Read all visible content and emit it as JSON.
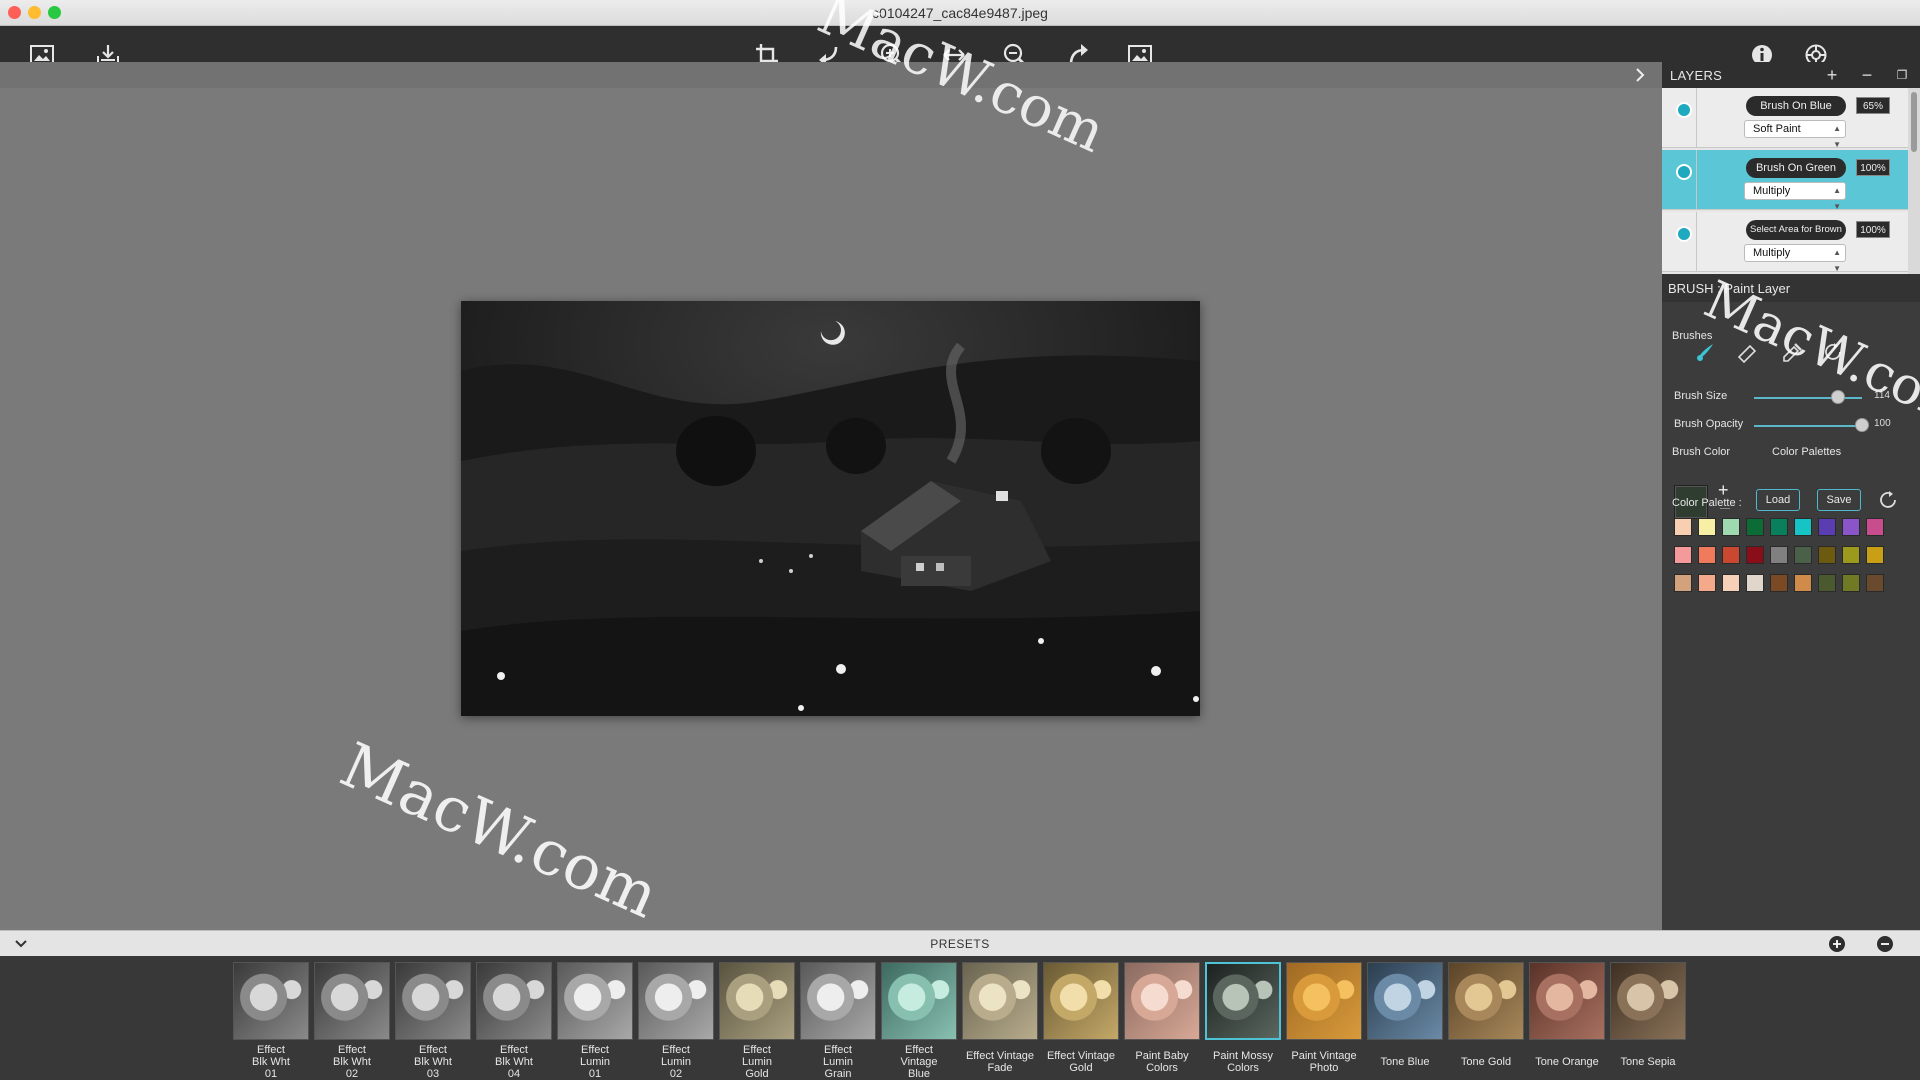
{
  "window": {
    "title": "c0104247_cac84e9487.jpeg"
  },
  "toolbar": {
    "left_icons": [
      "open-image-icon",
      "export-icon"
    ],
    "center_icons": [
      "crop-icon",
      "undo-icon",
      "zoom-in-icon",
      "fit-icon",
      "zoom-out-icon",
      "redo-icon",
      "compare-icon"
    ],
    "right_icons": [
      "info-icon",
      "settings-icon"
    ]
  },
  "layers": {
    "title": "LAYERS",
    "items": [
      {
        "name": "Brush On Blue",
        "opacity": "65%",
        "blend": "Soft Paint",
        "selected": false
      },
      {
        "name": "Brush On Green",
        "opacity": "100%",
        "blend": "Multiply",
        "selected": true
      },
      {
        "name": "Select Area for Brown",
        "opacity": "100%",
        "blend": "Multiply",
        "selected": false
      }
    ]
  },
  "brush": {
    "header": "BRUSH : Paint Layer",
    "brushes_label": "Brushes",
    "size_label": "Brush Size",
    "size_value": "114",
    "size_level": 0.78,
    "opacity_label": "Brush Opacity",
    "opacity_value": "100",
    "opacity_level": 1.0,
    "color_label": "Brush Color",
    "palettes_label": "Color Palettes",
    "load_label": "Load",
    "save_label": "Save",
    "palette_label": "Color Palette :",
    "current_color": "#2e3d30",
    "accent_color": "#4fb8cc",
    "palette_rows": [
      [
        "#f8cfb0",
        "#f6efa4",
        "#9ed9b0",
        "#0d6b36",
        "#0a7f5c",
        "#16c4c6",
        "#5a3db0",
        "#8a55c8",
        "#c84d8c"
      ],
      [
        "#f59a9a",
        "#ef7a5c",
        "#c9482f",
        "#8a0d1a",
        "#808080",
        "#4a6048",
        "#6b5a10",
        "#9b9a1c",
        "#c9a015"
      ],
      [
        "#d2a27c",
        "#f4a98b",
        "#f6d0b8",
        "#e0d6cc",
        "#7a4a24",
        "#d08a4a",
        "#4a5a2e",
        "#707a24",
        "#6a4a2c"
      ]
    ]
  },
  "presets": {
    "title": "PRESETS",
    "items": [
      {
        "label": "Effect\nBlk Wht\n01",
        "tone": "bw"
      },
      {
        "label": "Effect\nBlk Wht\n02",
        "tone": "bw"
      },
      {
        "label": "Effect\nBlk Wht\n03",
        "tone": "bw"
      },
      {
        "label": "Effect\nBlk Wht\n04",
        "tone": "bw"
      },
      {
        "label": "Effect\nLumin\n01",
        "tone": "bw-light"
      },
      {
        "label": "Effect\nLumin\n02",
        "tone": "bw-light"
      },
      {
        "label": "Effect\nLumin\nGold",
        "tone": "gold-pale"
      },
      {
        "label": "Effect\nLumin\nGrain",
        "tone": "bw-light"
      },
      {
        "label": "Effect\nVintage\nBlue",
        "tone": "mint"
      },
      {
        "label": "Effect Vintage\nFade",
        "tone": "fade"
      },
      {
        "label": "Effect Vintage\nGold",
        "tone": "gold"
      },
      {
        "label": "Paint Baby\nColors",
        "tone": "baby"
      },
      {
        "label": "Paint Mossy\nColors",
        "tone": "mossy"
      },
      {
        "label": "Paint Vintage\nPhoto",
        "tone": "vintage"
      },
      {
        "label": "Tone Blue",
        "tone": "blue"
      },
      {
        "label": "Tone Gold",
        "tone": "tgold"
      },
      {
        "label": "Tone Orange",
        "tone": "orange"
      },
      {
        "label": "Tone Sepia",
        "tone": "sepia"
      }
    ],
    "selected_index": 12
  },
  "watermark": {
    "text": "MacW.com"
  }
}
